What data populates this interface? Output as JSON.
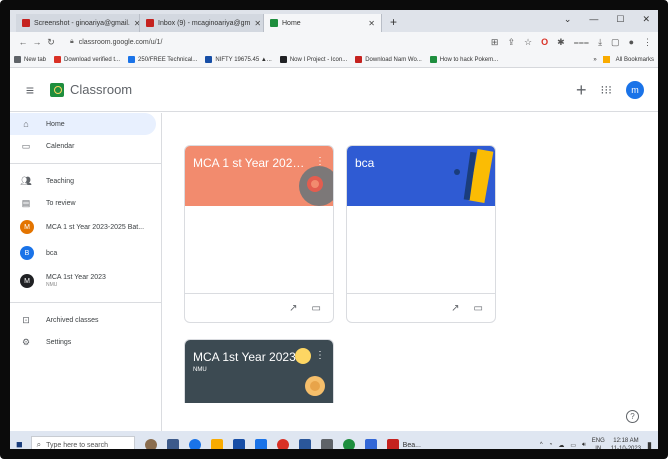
{
  "browser": {
    "tabs": [
      {
        "label": "Screenshot - ginoariya@gmail.",
        "color": "#c5221f",
        "active": false
      },
      {
        "label": "Inbox (9) - mcaginoariya@gm",
        "color": "#c5221f",
        "active": false
      },
      {
        "label": "Home",
        "color": "#1e8e3e",
        "active": true
      }
    ],
    "new_tab": "+",
    "url": "classroom.google.com/u/1/",
    "bookmarks": [
      "New tab",
      "Download verified t...",
      "250/FREE Technical...",
      "NIFTY 19675.45 ▲...",
      "Now I Project - Icon...",
      "Download Nam Wo...",
      "How to hack Pokem..."
    ],
    "all_bookmarks": "All Bookmarks"
  },
  "app": {
    "title": "Classroom",
    "avatar_letter": "m"
  },
  "sidebar": {
    "home": "Home",
    "calendar": "Calendar",
    "teaching": "Teaching",
    "to_review": "To review",
    "classes": [
      {
        "letter": "M",
        "label": "MCA 1 st Year 2023-2025 Bat...",
        "sub": "",
        "color": "#e37400"
      },
      {
        "letter": "B",
        "label": "bca",
        "sub": "",
        "color": "#1a73e8"
      },
      {
        "letter": "M",
        "label": "MCA 1st Year 2023",
        "sub": "NMU",
        "color": "#202124"
      }
    ],
    "archived": "Archived classes",
    "settings": "Settings"
  },
  "cards": [
    {
      "title": "MCA 1 st Year 2023-2...",
      "subtitle": "",
      "color": "#f28b6e"
    },
    {
      "title": "bca",
      "subtitle": "",
      "color": "#2f5bd3"
    },
    {
      "title": "MCA 1st Year 2023",
      "subtitle": "NMU",
      "color": "#3c4a52"
    }
  ],
  "taskbar": {
    "search_placeholder": "Type here to search",
    "running_label": "Bea...",
    "language": "ENG",
    "language_sub": "IN",
    "time": "12:18 AM",
    "date": "11-10-2023"
  }
}
